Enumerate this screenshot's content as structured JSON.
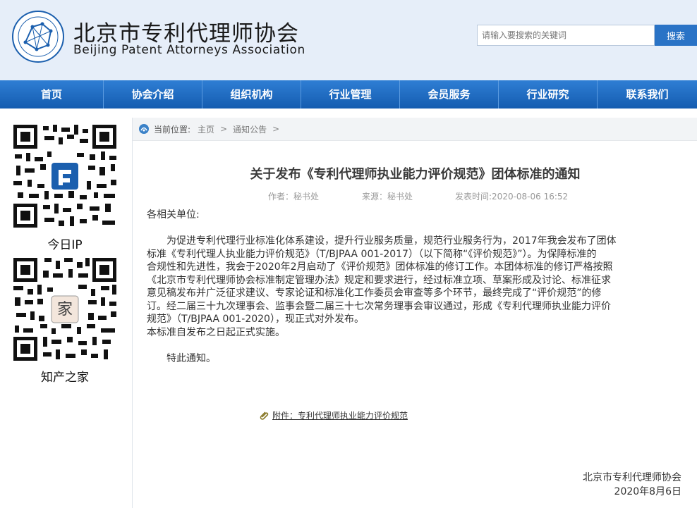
{
  "header": {
    "title_cn": "北京市专利代理师协会",
    "title_en": "Beijing Patent Attorneys Association",
    "search_placeholder": "请输入要搜索的关键词",
    "search_button": "搜索"
  },
  "nav": {
    "items": [
      "首页",
      "协会介绍",
      "组织机构",
      "行业管理",
      "会员服务",
      "行业研究",
      "联系我们"
    ]
  },
  "sidebar": {
    "qr1_label": "今日IP",
    "qr2_label": "知产之家"
  },
  "breadcrumb": {
    "label": "当前位置:",
    "items": [
      "主页",
      "通知公告"
    ],
    "sep": ">"
  },
  "article": {
    "title": "关于发布《专利代理师执业能力评价规范》团体标准的通知",
    "author": "作者：秘书处",
    "source": "来源：秘书处",
    "date": "发表时间:2020-08-06 16:52",
    "salutation": "各相关单位:",
    "paragraph1_lines": [
      "为促进专利代理行业标准化体系建设，提升行业服务质量，规范行业服务行为，2017年我会发布了团体",
      "标准《专利代理人执业能力评价规范》（T/BJPAA 001-2017）（以下简称“《评价规范》”）。为保障标准的",
      "合规性和先进性，我会于2020年2月启动了《评价规范》团体标准的修订工作。本团体标准的修订严格按照",
      "《北京市专利代理师协会标准制定管理办法》规定和要求进行，经过标准立项、草案形成及讨论、标准征求",
      "意见稿发布并广泛征求建议、专家论证和标准化工作委员会审查等多个环节，最终完成了“评价规范”的修",
      "订。经二届三十九次理事会、监事会暨二届三十七次常务理事会审议通过，形成《专利代理师执业能力评价",
      "规范》（T/BJPAA 001-2020），现正式对外发布。"
    ],
    "paragraph2": "本标准自发布之日起正式实施。",
    "closing": "特此通知。",
    "attachment": "附件：专利代理师执业能力评价规范",
    "sign_org": "北京市专利代理师协会",
    "sign_date": "2020年8月6日"
  },
  "colors": {
    "header_bg": "#e6eef9",
    "nav_bg": "#2a73c6",
    "search_button_bg": "#2a73c6"
  }
}
